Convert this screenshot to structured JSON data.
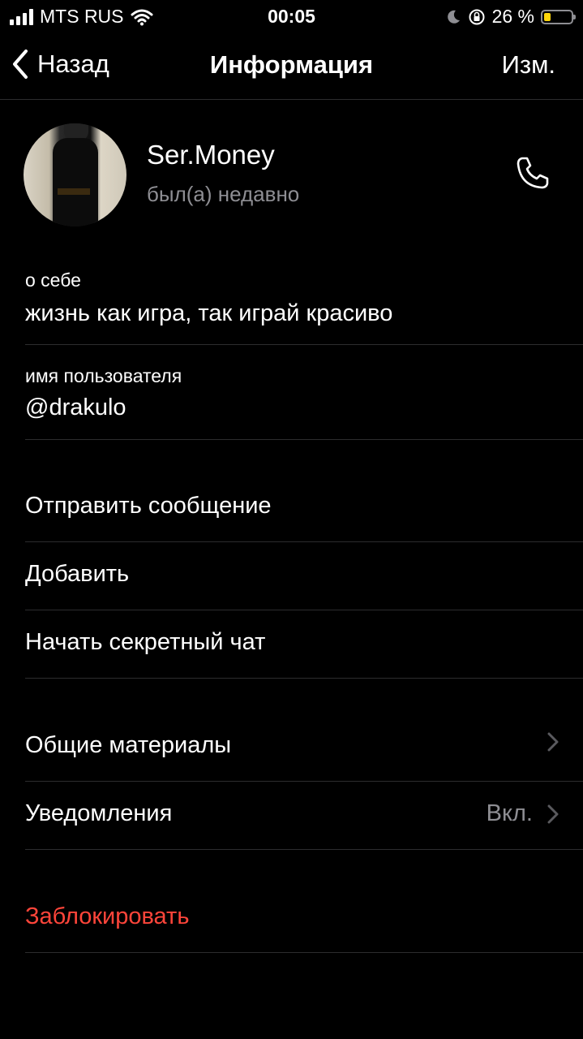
{
  "status_bar": {
    "carrier": "MTS RUS",
    "time": "00:05",
    "battery_percent": "26 %",
    "battery_level": 0.26
  },
  "nav": {
    "back_label": "Назад",
    "title": "Информация",
    "edit_label": "Изм."
  },
  "profile": {
    "name": "Ser.Money",
    "status": "был(а) недавно"
  },
  "about": {
    "label": "о себе",
    "value": "жизнь как игра, так играй красиво"
  },
  "username": {
    "label": "имя пользователя",
    "value": "@drakulo"
  },
  "actions": [
    {
      "label": "Отправить сообщение"
    },
    {
      "label": "Добавить"
    },
    {
      "label": "Начать секретный чат"
    }
  ],
  "media": {
    "label": "Общие материалы"
  },
  "notifications": {
    "label": "Уведомления",
    "value": "Вкл."
  },
  "block": {
    "label": "Заблокировать"
  },
  "colors": {
    "background": "#000000",
    "danger": "#ff453a",
    "secondary": "#8e8e93",
    "battery": "#ffd60a"
  }
}
